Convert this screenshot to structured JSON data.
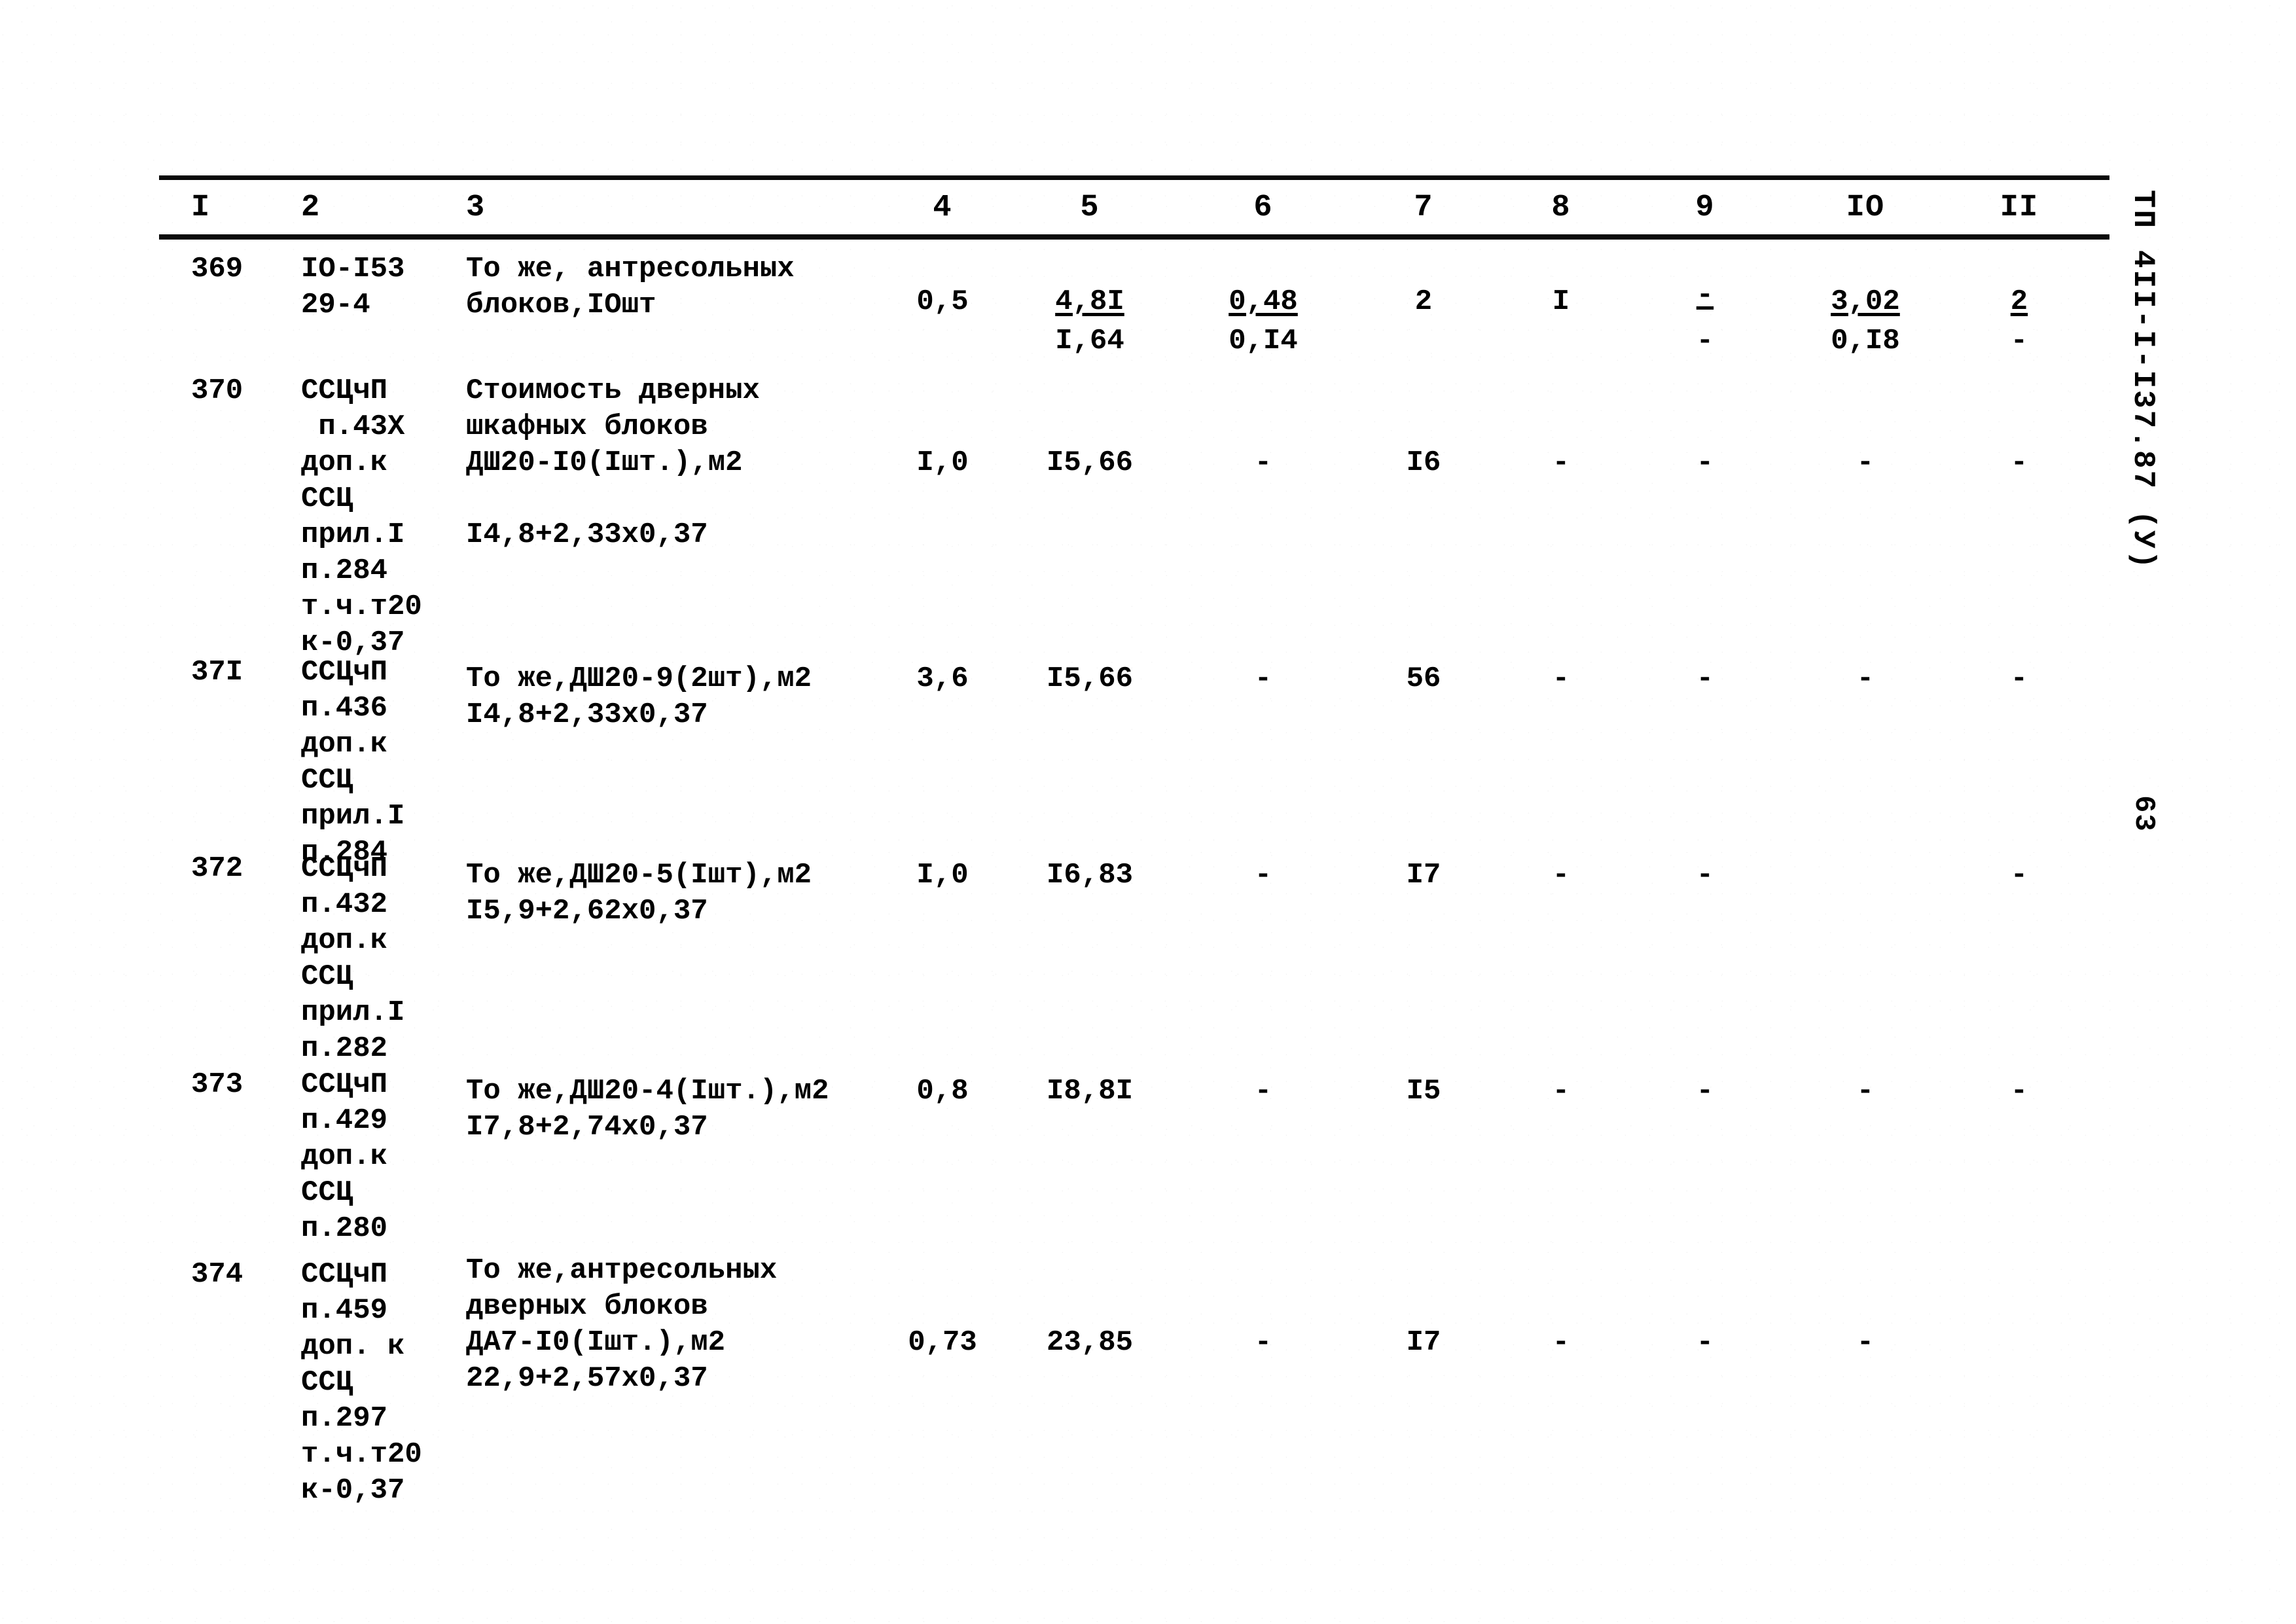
{
  "document": {
    "side_code": "ТП 4II-I-I37.87 (У)",
    "page_number": "63"
  },
  "table": {
    "column_headers": [
      "I",
      "2",
      "3",
      "4",
      "5",
      "6",
      "7",
      "8",
      "9",
      "IO",
      "II"
    ],
    "rows": [
      {
        "col1": "369",
        "col2": "IO-I53\n29-4",
        "col3": "То же, антресольных\nблоков,IOшт",
        "col4": "0,5",
        "col5_top": "4,8I",
        "col5_bottom": "I,64",
        "col6_top": "0,48",
        "col6_bottom": "0,I4",
        "col7": "2",
        "col8": "I",
        "col9_top": "-",
        "col9_bottom": "-",
        "col10_top": "3,02",
        "col10_bottom": "0,I8",
        "col11_top": "2",
        "col11_bottom": "-"
      },
      {
        "col1": "370",
        "col2": "ССЦчП\n п.43X\nдоп.к\nССЦ\nприл.I\nп.284\nт.ч.т20\nк-0,37",
        "col3": "Стоимость дверных\nшкафных блоков\nДШ20-I0(Iшт.),м2\n\nI4,8+2,33х0,37",
        "col4": "I,0",
        "col5": "I5,66",
        "col6": "-",
        "col7": "I6",
        "col8": "-",
        "col9": "-",
        "col10": "-",
        "col11": "-"
      },
      {
        "col1": "37I",
        "col2": "ССЦчП\nп.436\nдоп.к\nССЦ\nприл.I\nп.284",
        "col3": "То же,ДШ20-9(2шт),м2\nI4,8+2,33х0,37",
        "col4": "3,6",
        "col5": "I5,66",
        "col6": "-",
        "col7": "56",
        "col8": "-",
        "col9": "-",
        "col10": "-",
        "col11": "-"
      },
      {
        "col1": "372",
        "col2": "ССЦчП\nп.432\nдоп.к\nССЦ\nприл.I\nп.282",
        "col3": "То же,ДШ20-5(Iшт),м2\nI5,9+2,62х0,37",
        "col4": "I,0",
        "col5": "I6,83",
        "col6": "-",
        "col7": "I7",
        "col8": "-",
        "col9": "-",
        "col10": "",
        "col11": "-"
      },
      {
        "col1": "373",
        "col2": "ССЦчП\nп.429\nдоп.к\nССЦ\nп.280",
        "col3": "То же,ДШ20-4(Iшт.),м2\nI7,8+2,74х0,37",
        "col4": "0,8",
        "col5": "I8,8I",
        "col6": "-",
        "col7": "I5",
        "col8": "-",
        "col9": "-",
        "col10": "-",
        "col11": "-"
      },
      {
        "col1": "374",
        "col2": "ССЦчП\nп.459\nдоп. к\nССЦ\nп.297\nт.ч.т20\nк-0,37",
        "col3": "То же,антресольных\nдверных блоков\nДА7-I0(Iшт.),м2\n22,9+2,57х0,37",
        "col4": "0,73",
        "col5": "23,85",
        "col6": "-",
        "col7": "I7",
        "col8": "-",
        "col9": "-",
        "col10": "-",
        "col11": ""
      }
    ]
  }
}
